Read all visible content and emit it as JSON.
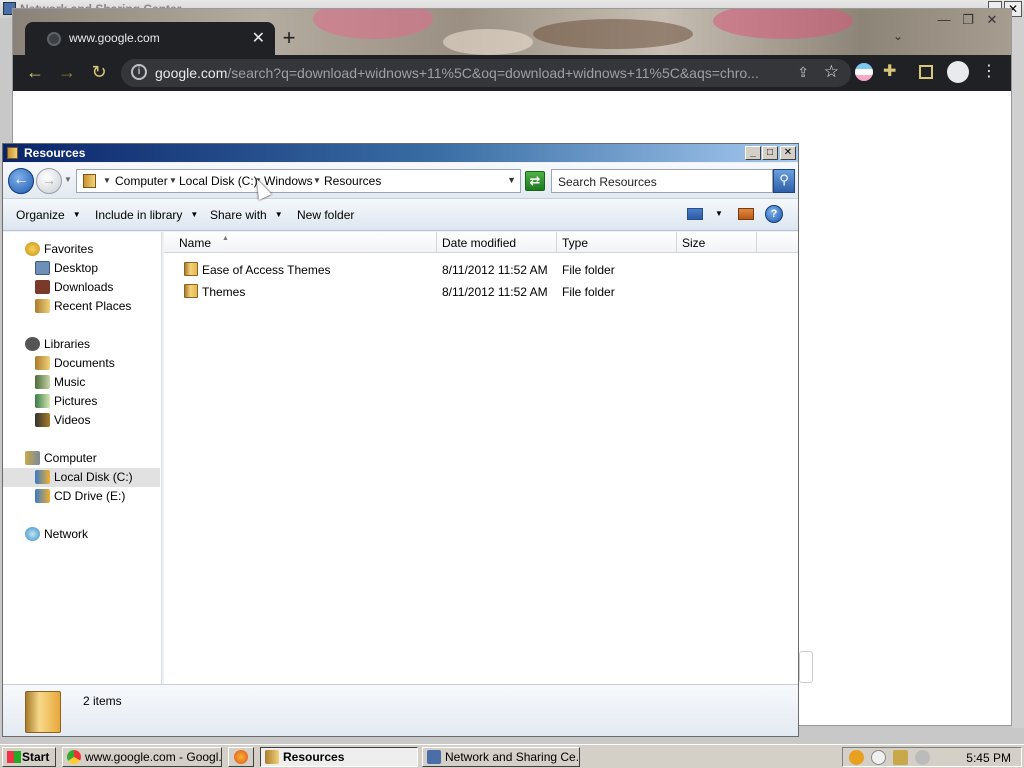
{
  "background_window": {
    "title": "Network and Sharing Center"
  },
  "chrome": {
    "tab_title": "www.google.com",
    "tab_close": "✕",
    "new_tab": "+",
    "url_domain": "google.com",
    "url_path": "/search?q=download+widnows+11%5C&oq=download+widnows+11%5C&aqs=chro..."
  },
  "explorer": {
    "title": "Resources",
    "breadcrumbs": [
      "Computer",
      "Local Disk (C:)",
      "Windows",
      "Resources"
    ],
    "search_placeholder": "Search Resources",
    "commands": {
      "organize": "Organize",
      "include_in_library": "Include in library",
      "share_with": "Share with",
      "new_folder": "New folder"
    },
    "nav": {
      "favorites": "Favorites",
      "desktop": "Desktop",
      "downloads": "Downloads",
      "recent_places": "Recent Places",
      "libraries": "Libraries",
      "documents": "Documents",
      "music": "Music",
      "pictures": "Pictures",
      "videos": "Videos",
      "computer": "Computer",
      "local_disk": "Local Disk (C:)",
      "cd_drive": "CD Drive (E:)",
      "network": "Network"
    },
    "columns": {
      "name": "Name",
      "date_modified": "Date modified",
      "type": "Type",
      "size": "Size"
    },
    "files": [
      {
        "name": "Ease of Access Themes",
        "date_modified": "8/11/2012 11:52 AM",
        "type": "File folder",
        "size": ""
      },
      {
        "name": "Themes",
        "date_modified": "8/11/2012 11:52 AM",
        "type": "File folder",
        "size": ""
      }
    ],
    "status": "2 items"
  },
  "taskbar": {
    "start": "Start",
    "tasks": {
      "chrome": "www.google.com - Googl...",
      "resources": "Resources",
      "network": "Network and Sharing Ce..."
    },
    "clock": "5:45 PM"
  },
  "colors": {
    "chrome_dark": "#202124",
    "title_blue": "#0a246a",
    "accent": "#1d5bb0"
  }
}
